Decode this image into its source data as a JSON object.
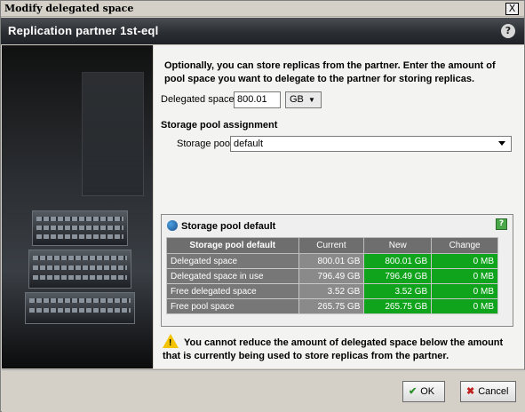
{
  "window": {
    "title": "Modify delegated space",
    "close_label": "X"
  },
  "header": {
    "title": "Replication partner 1st-eql",
    "help_label": "?"
  },
  "intro_text": "Optionally, you can store replicas from the partner. Enter the amount of pool space you want to delegate to the partner for storing replicas.",
  "delegated": {
    "label": "Delegated space:",
    "value": "800.01",
    "unit": "GB"
  },
  "assignment": {
    "title": "Storage pool assignment",
    "pool_label": "Storage pool:",
    "pool_value": "default"
  },
  "panel": {
    "title": "Storage pool default",
    "help_label": "?",
    "columns": [
      "Storage pool default",
      "Current",
      "New",
      "Change"
    ],
    "rows": [
      {
        "label": "Delegated space",
        "current": "800.01 GB",
        "new": "800.01 GB",
        "change": "0 MB"
      },
      {
        "label": "Delegated space in use",
        "current": "796.49 GB",
        "new": "796.49 GB",
        "change": "0 MB"
      },
      {
        "label": "Free delegated space",
        "current": "3.52 GB",
        "new": "3.52 GB",
        "change": "0 MB"
      },
      {
        "label": "Free pool space",
        "current": "265.75 GB",
        "new": "265.75 GB",
        "change": "0 MB"
      }
    ]
  },
  "warning_text": "You cannot reduce the amount of delegated space below the amount that is currently being used to store replicas from the partner.",
  "footer": {
    "ok_label": "OK",
    "cancel_label": "Cancel"
  },
  "colors": {
    "new_cell": "#10a31c",
    "header_bg": "#2b2e33",
    "warning": "#f4c400"
  }
}
